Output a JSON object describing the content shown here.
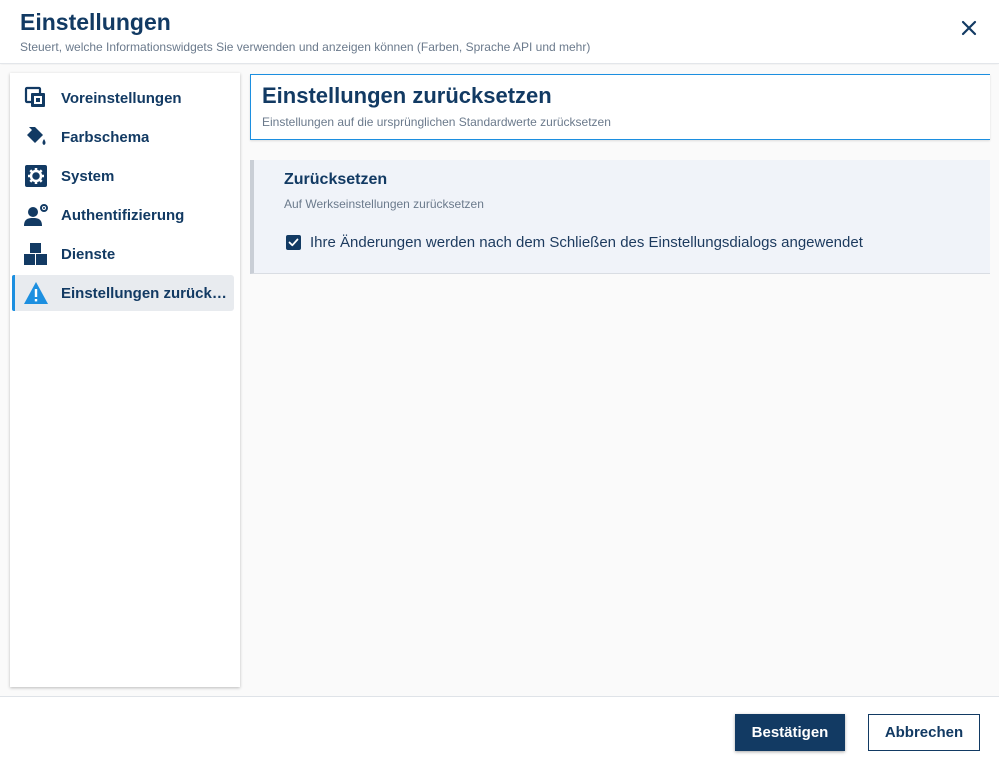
{
  "dialog": {
    "title": "Einstellungen",
    "subtitle": "Steuert, welche Informationswidgets Sie verwenden und anzeigen können (Farben, Sprache API und mehr)",
    "close_icon": "close-icon"
  },
  "sidebar": {
    "items": [
      {
        "label": "Voreinstellungen",
        "icon": "presets-icon"
      },
      {
        "label": "Farbschema",
        "icon": "paint-bucket-icon"
      },
      {
        "label": "System",
        "icon": "gear-icon"
      },
      {
        "label": "Authentifizierung",
        "icon": "user-settings-icon"
      },
      {
        "label": "Dienste",
        "icon": "blocks-icon"
      },
      {
        "label": "Einstellungen zurücks…",
        "icon": "warning-icon",
        "active": true
      }
    ]
  },
  "section": {
    "title": "Einstellungen zurücksetzen",
    "subtitle": "Einstellungen auf die ursprünglichen Standardwerte zurücksetzen"
  },
  "reset_card": {
    "title": "Zurücksetzen",
    "subtitle": "Auf Werkseinstellungen zurücksetzen",
    "checkbox_label": "Ihre Änderungen werden nach dem Schließen des Einstellungsdialogs angewendet",
    "checked": true
  },
  "footer": {
    "confirm_label": "Bestätigen",
    "cancel_label": "Abbrechen"
  },
  "colors": {
    "primary": "#123a63",
    "accent": "#1c8fe0",
    "warning": "#1c8fe0"
  }
}
